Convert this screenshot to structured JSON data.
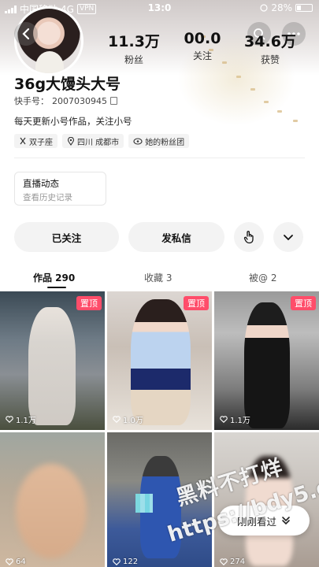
{
  "status_bar": {
    "carrier": "中国移动",
    "network": "4G",
    "vpn": "VPN",
    "time": "13:0",
    "battery": "28%",
    "battery_level": 0.28
  },
  "profile": {
    "username": "36g大馒头大号",
    "kuaishou_id_label": "快手号：",
    "kuaishou_id": "2007030945",
    "bio": "每天更新小号作品，关注小号",
    "tags": [
      {
        "icon": "zodiac-icon",
        "label": "双子座"
      },
      {
        "icon": "location-icon",
        "label": "四川 成都市"
      },
      {
        "icon": "fans-group-icon",
        "label": "她的粉丝团"
      }
    ]
  },
  "stats": {
    "fans": {
      "value": "11.3万",
      "label": "粉丝"
    },
    "following": {
      "value": "00.0",
      "label": "关注"
    },
    "likes": {
      "value": "34.6万",
      "label": "获赞"
    }
  },
  "live": {
    "title": "直播动态",
    "subtitle": "查看历史记录"
  },
  "actions": {
    "followed": "已关注",
    "message": "发私信"
  },
  "tabs": {
    "works": "作品 290",
    "favorites": "收藏 3",
    "tagged": "被@ 2"
  },
  "grid": [
    {
      "pinned": true,
      "pin_label": "置顶",
      "likes": "1.1万"
    },
    {
      "pinned": true,
      "pin_label": "置顶",
      "likes": "1.0万"
    },
    {
      "pinned": true,
      "pin_label": "置顶",
      "likes": "1.1万"
    },
    {
      "pinned": false,
      "likes": "64"
    },
    {
      "pinned": false,
      "likes": "122"
    },
    {
      "pinned": false,
      "likes": "274"
    }
  ],
  "floating": {
    "recent_label": "刚刚看过"
  },
  "watermark": {
    "line1": "黑料不打烊",
    "line2": "https://bdy5.co"
  },
  "colors": {
    "pin_badge": "#ff4d6a",
    "pill_bg": "#f3f3f3",
    "text_primary": "#111111"
  }
}
